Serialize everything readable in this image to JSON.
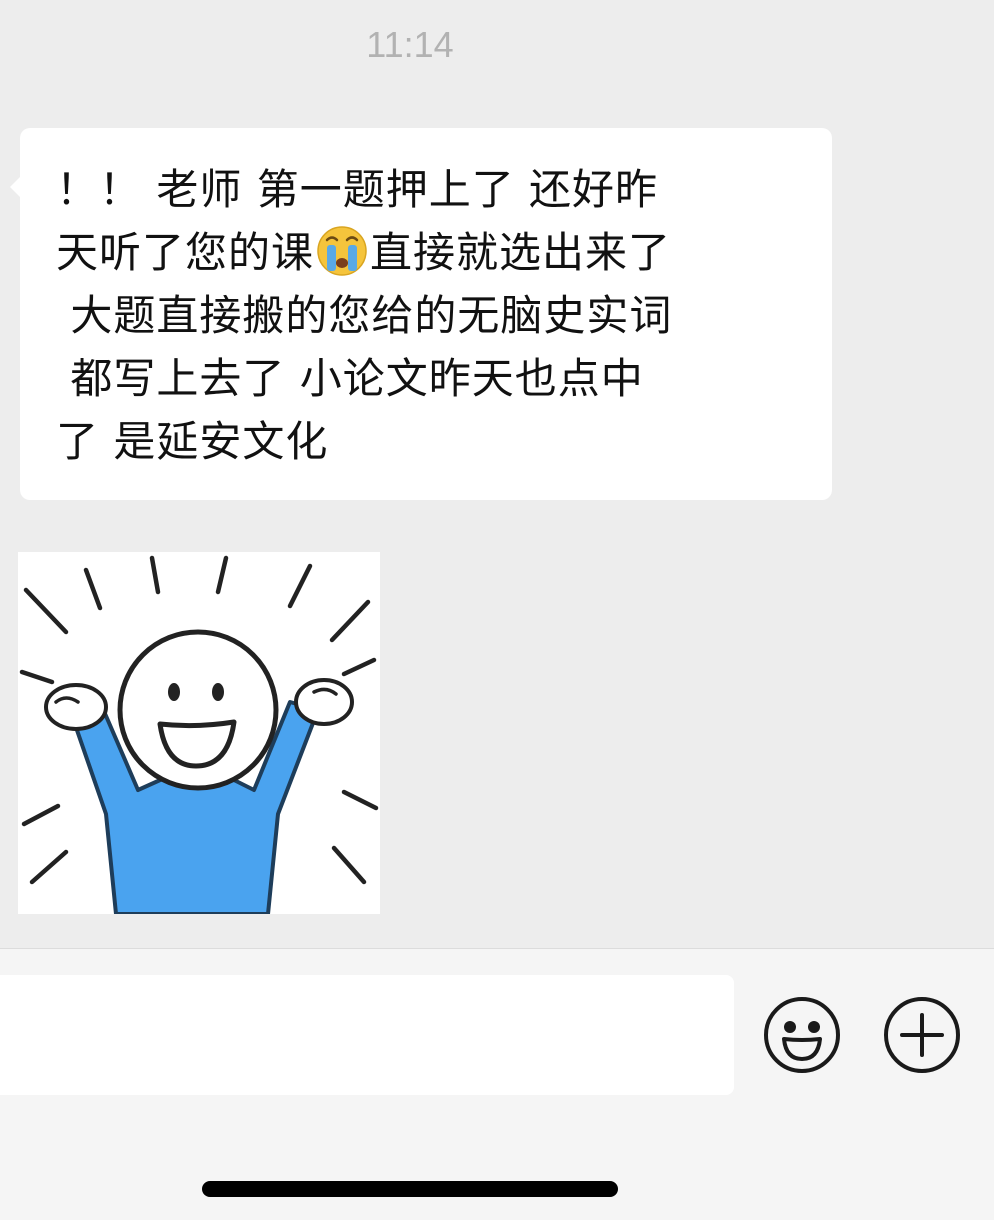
{
  "timestamp": "11:14",
  "message": {
    "part1": "！！ 老师 第一题押上了 还好昨\n天听了您的课",
    "emoji": "crying-face-icon",
    "part2": "直接就选出来了\n 大题直接搬的您给的无脑史实词\n 都写上去了 小论文昨天也点中\n了 是延安文化"
  },
  "sticker": {
    "icon": "cheering-stickman-sticker",
    "shirt_color": "#4aa3ef"
  },
  "input_bar": {
    "input_value": "",
    "emoji_button_icon": "smiley-face-icon",
    "more_button_icon": "plus-circle-icon"
  },
  "colors": {
    "background": "#ededed",
    "bubble": "#ffffff",
    "timestamp": "#b2b2b2"
  }
}
